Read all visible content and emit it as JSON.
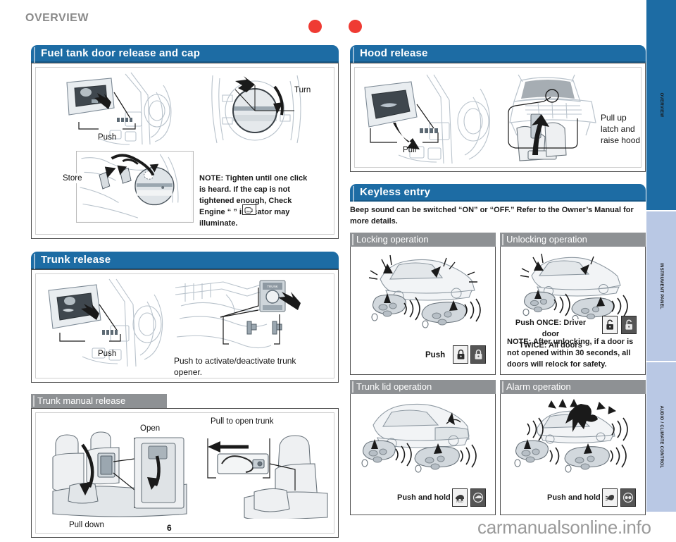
{
  "header": {
    "chapter": "OVERVIEW",
    "dot_color": "#ef3b33"
  },
  "left_column": {
    "sections": [
      {
        "title": "Fuel tank door release and cap",
        "captions": [
          "Push",
          "Turn",
          "Store"
        ],
        "note": "NOTE: Tighten until one click is heard. If the cap is not tightened enough, Check Engine “     ” indicator may illuminate.",
        "note_icon": "check-engine-icon"
      },
      {
        "title": "Trunk release",
        "captions": [
          "Push",
          "Push to activate/deactivate trunk opener."
        ]
      },
      {
        "title": "Trunk manual release",
        "captions": [
          "Open",
          "Pull to open trunk",
          "Pull down"
        ]
      }
    ]
  },
  "right_column": {
    "sections": [
      {
        "title": "Hood release",
        "captions": [
          "Pull",
          "Pull up latch and raise hood"
        ]
      },
      {
        "title": "Keyless entry",
        "intro": "Beep sound can be switched “ON” or “OFF.” Refer to the Owner’s Manual for more details.",
        "cells": [
          {
            "title": "Locking operation",
            "caption": "Push",
            "icons": [
              "lock-closed-light-icon",
              "lock-closed-dark-icon"
            ]
          },
          {
            "title": "Unlocking operation",
            "caption": "Push ONCE: Driver door TWICE: All doors",
            "caption_line1": "Push ONCE: Driver door",
            "caption_line2": "TWICE: All doors",
            "note": "NOTE: After unlocking, if a door is not opened within 30 seconds, all doors will relock for safety.",
            "icons": [
              "lock-open-light-icon",
              "lock-open-dark-icon"
            ]
          },
          {
            "title": "Trunk lid operation",
            "caption": "Push and hold",
            "icons": [
              "trunk-hold-light-icon",
              "trunk-dark-icon"
            ]
          },
          {
            "title": "Alarm operation",
            "caption": "Push and hold",
            "icons": [
              "alarm-light-icon",
              "alarm-dark-icon"
            ]
          }
        ]
      }
    ]
  },
  "index_tabs": [
    {
      "label": "OVERVIEW",
      "color": "#1d6ca4"
    },
    {
      "label": "INSTRUMENT PANEL",
      "color": "#b9c8e4"
    },
    {
      "label": "AUDIO / CLIMATE CONTROL",
      "color": "#b9c8e4"
    }
  ],
  "footer": {
    "page_number": "6",
    "watermark": "carmanualsonline.info"
  }
}
